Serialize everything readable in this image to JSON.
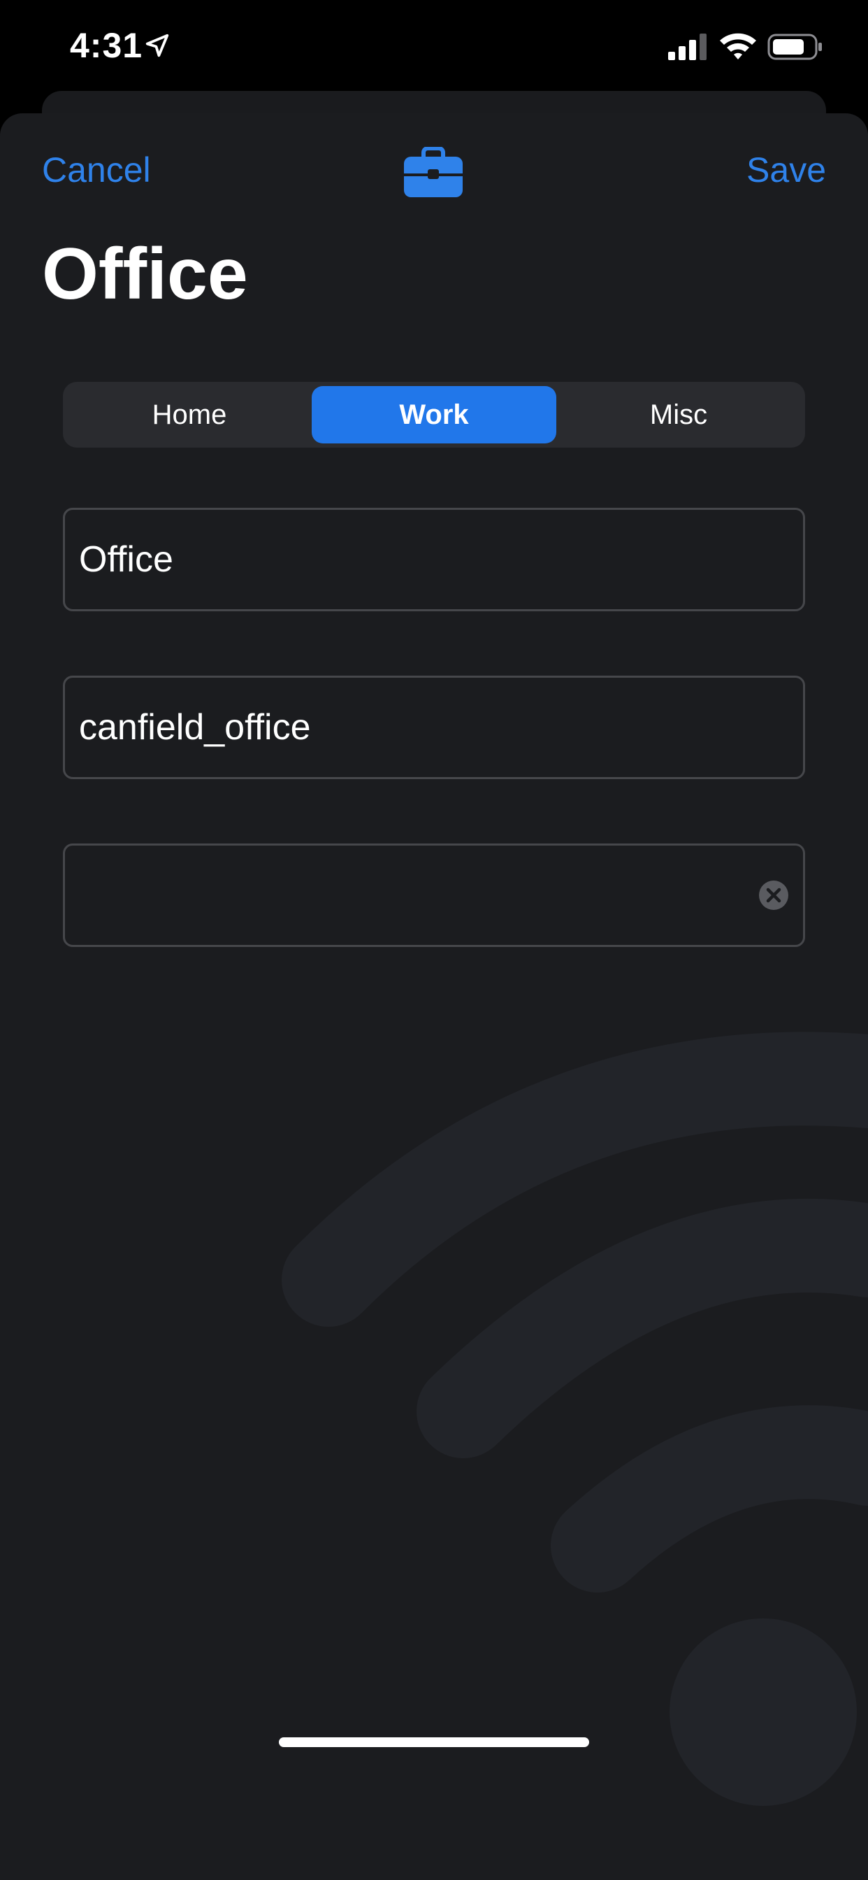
{
  "status_bar": {
    "time": "4:31",
    "icons": [
      "location-arrow-icon",
      "cellular-signal-icon",
      "wifi-icon",
      "battery-icon"
    ]
  },
  "nav": {
    "cancel_label": "Cancel",
    "save_label": "Save",
    "center_icon": "briefcase-icon"
  },
  "title": "Office",
  "segments": {
    "items": [
      {
        "label": "Home"
      },
      {
        "label": "Work"
      },
      {
        "label": "Misc"
      }
    ],
    "selected": "Work"
  },
  "fields": {
    "name": {
      "value": "Office",
      "placeholder": ""
    },
    "network": {
      "value": "canfield_office",
      "placeholder": ""
    },
    "extra": {
      "value": "",
      "placeholder": "",
      "clear_icon": "clear-circle-icon"
    }
  },
  "colors": {
    "accent": "#2f82ea",
    "segment_active": "#2177ea",
    "background": "#1b1c1f",
    "watermark": "#222429"
  }
}
